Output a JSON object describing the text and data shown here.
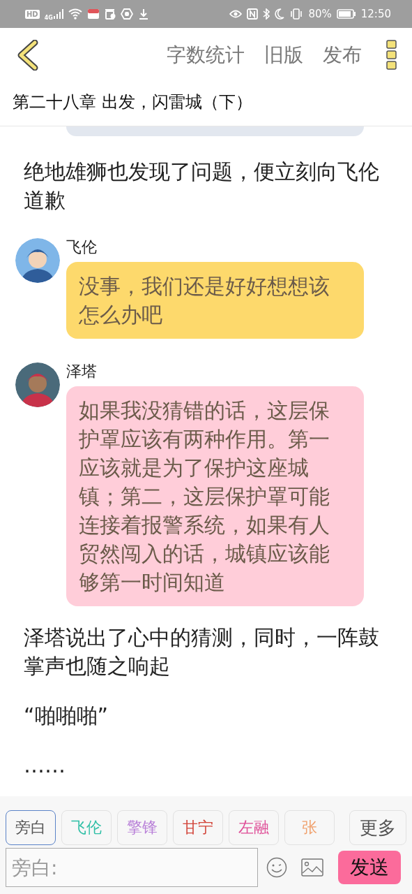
{
  "status_bar": {
    "hd": "HD",
    "network": "4G",
    "battery": "80%",
    "time": "12:50"
  },
  "header": {
    "actions": [
      "字数统计",
      "旧版",
      "发布"
    ]
  },
  "chapter_title": "第二十八章 出发，闪雷城（下）",
  "messages": [
    {
      "kind": "narration",
      "text": "绝地雄狮也发现了问题，便立刻向飞伦道歉"
    },
    {
      "kind": "dialogue",
      "speaker": "飞伦",
      "color": "#fdd96c",
      "text": "没事，我们还是好好想想该怎么办吧"
    },
    {
      "kind": "dialogue",
      "speaker": "泽塔",
      "color": "#ffcdd9",
      "text": "如果我没猜错的话，这层保护罩应该有两种作用。第一应该就是为了保护这座城镇；第二，这层保护罩可能连接着报警系统，如果有人贸然闯入的话，城镇应该能够第一时间知道"
    },
    {
      "kind": "narration",
      "text": "泽塔说出了心中的猜测，同时，一阵鼓掌声也随之响起"
    },
    {
      "kind": "narration",
      "text": "“啪啪啪”"
    },
    {
      "kind": "narration",
      "text": "……"
    }
  ],
  "characters": [
    {
      "name": "旁白",
      "color": "#555555",
      "selected": true
    },
    {
      "name": "飞伦",
      "color": "#2fbfa6",
      "selected": false
    },
    {
      "name": "擎锋",
      "color": "#b87fd8",
      "selected": false
    },
    {
      "name": "甘宁",
      "color": "#d2453a",
      "selected": false
    },
    {
      "name": "左融",
      "color": "#df4f98",
      "selected": false
    },
    {
      "name": "张",
      "color": "#f0a06c",
      "selected": false
    }
  ],
  "more_button": "更多",
  "input": {
    "placeholder": "旁白:"
  },
  "send_button": "发送"
}
